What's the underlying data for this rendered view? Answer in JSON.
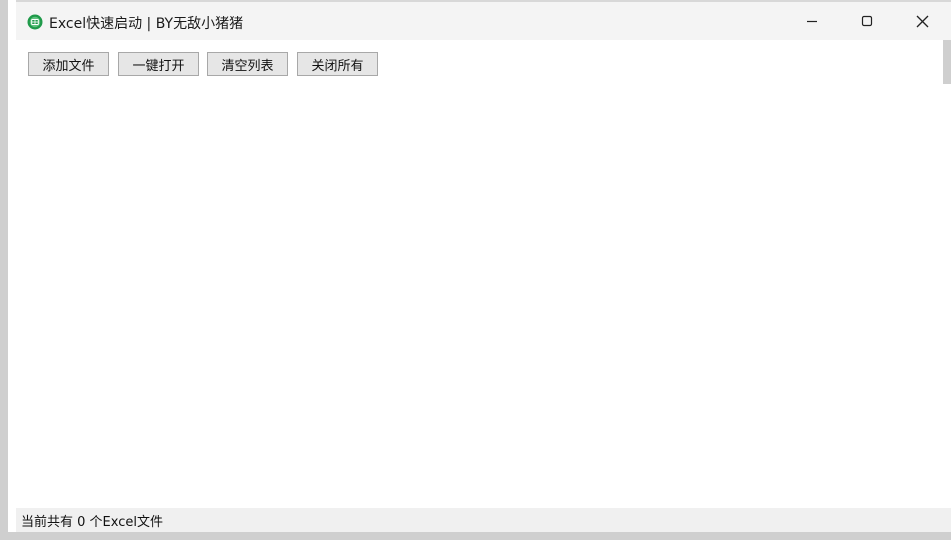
{
  "window": {
    "title": "Excel快速启动 | BY无敌小猪猪",
    "icon": "excel-app-icon",
    "controls": {
      "minimize_icon": "minimize-icon",
      "maximize_icon": "maximize-icon",
      "close_icon": "close-icon"
    }
  },
  "toolbar": {
    "add_files_label": "添加文件",
    "open_all_label": "一键打开",
    "clear_list_label": "清空列表",
    "close_all_label": "关闭所有"
  },
  "file_list": {
    "items": []
  },
  "status": {
    "text": "当前共有 0 个Excel文件"
  },
  "colors": {
    "titlebar_bg": "#f4f4f4",
    "button_bg": "#e6e6e6",
    "button_border": "#a8a8a8",
    "statusbar_bg": "#f0f0f0",
    "app_icon_green": "#1f9a4a"
  }
}
